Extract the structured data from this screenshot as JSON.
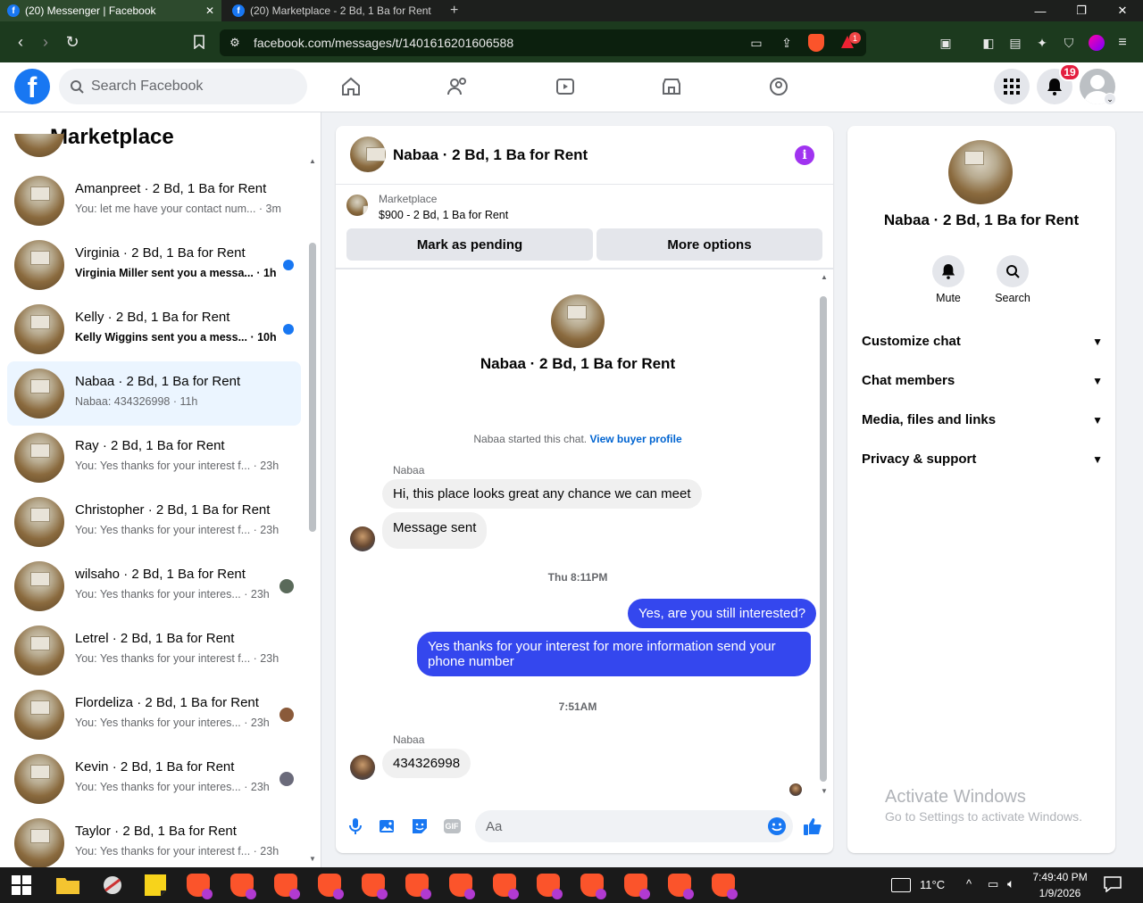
{
  "browser": {
    "tabs": [
      {
        "title": "(20) Messenger | Facebook",
        "active": true
      },
      {
        "title": "(20) Marketplace - 2 Bd, 1 Ba for Rent",
        "active": false
      }
    ],
    "new_tab": "+",
    "url": "facebook.com/messages/t/1401616201606588",
    "brave_badge": "1"
  },
  "fb_header": {
    "logo": "f",
    "search_placeholder": "Search Facebook",
    "notification_count": "19"
  },
  "left_panel": {
    "title": "Marketplace",
    "conversations": [
      {
        "name": "Amanpreet · 2 Bd, 1 Ba for Rent",
        "preview": "You: let me have your contact num... · 3m",
        "unread": false,
        "active": false
      },
      {
        "name": "Virginia · 2 Bd, 1 Ba for Rent",
        "preview": "Virginia Miller sent you a messa... · 1h",
        "unread": true,
        "active": false
      },
      {
        "name": "Kelly · 2 Bd, 1 Ba for Rent",
        "preview": "Kelly Wiggins sent you a mess... · 10h",
        "unread": true,
        "active": false
      },
      {
        "name": "Nabaa · 2 Bd, 1 Ba for Rent",
        "preview": "Nabaa: 434326998 · 11h",
        "unread": false,
        "active": true
      },
      {
        "name": "Ray · 2 Bd, 1 Ba for Rent",
        "preview": "You: Yes thanks for your interest f... · 23h",
        "unread": false,
        "active": false
      },
      {
        "name": "Christopher · 2 Bd, 1 Ba for Rent",
        "preview": "You: Yes thanks for your interest f... · 23h",
        "unread": false,
        "active": false
      },
      {
        "name": "wilsaho · 2 Bd, 1 Ba for Rent",
        "preview": "You: Yes thanks for your interes... · 23h",
        "unread": false,
        "active": false
      },
      {
        "name": "Letrel · 2 Bd, 1 Ba for Rent",
        "preview": "You: Yes thanks for your interest f... · 23h",
        "unread": false,
        "active": false
      },
      {
        "name": "Flordeliza · 2 Bd, 1 Ba for Rent",
        "preview": "You: Yes thanks for your interes... · 23h",
        "unread": false,
        "active": false
      },
      {
        "name": "Kevin · 2 Bd, 1 Ba for Rent",
        "preview": "You: Yes thanks for your interes... · 23h",
        "unread": false,
        "active": false
      },
      {
        "name": "Taylor · 2 Bd, 1 Ba for Rent",
        "preview": "You: Yes thanks for your interest f... · 23h",
        "unread": false,
        "active": false
      }
    ]
  },
  "chat": {
    "title": "Nabaa · 2 Bd, 1 Ba for Rent",
    "info_icon": "i",
    "marketplace_label": "Marketplace",
    "listing": "$900 - 2 Bd, 1 Ba for Rent",
    "mark_pending": "Mark as pending",
    "more_options": "More options",
    "intro_title": "Nabaa · 2 Bd, 1 Ba for Rent",
    "started_text": "Nabaa started this chat.",
    "buyer_profile": "View buyer profile",
    "sender1": "Nabaa",
    "msg1": "Hi, this place looks great any chance we can meet",
    "msg2": "Message sent",
    "time1": "Thu 8:11PM",
    "out1": "Yes, are you still interested?",
    "out2": "Yes thanks for your interest for more information send your phone number",
    "time2": "7:51AM",
    "sender2": "Nabaa",
    "msg3": "434326998",
    "composer_placeholder": "Aa",
    "gif_label": "GIF"
  },
  "right_panel": {
    "name": "Nabaa · 2 Bd, 1 Ba for Rent",
    "mute": "Mute",
    "search": "Search",
    "items": [
      "Customize chat",
      "Chat members",
      "Media, files and links",
      "Privacy & support"
    ],
    "watermark_title": "Activate Windows",
    "watermark_sub": "Go to Settings to activate Windows."
  },
  "taskbar": {
    "temperature": "11°C",
    "time": "7:49:40 PM",
    "date": "1/9/2026"
  },
  "colors": {
    "fb_blue": "#1877f2",
    "outgoing_bubble": "#3447ee",
    "browser_bar": "#1c3a1e"
  }
}
